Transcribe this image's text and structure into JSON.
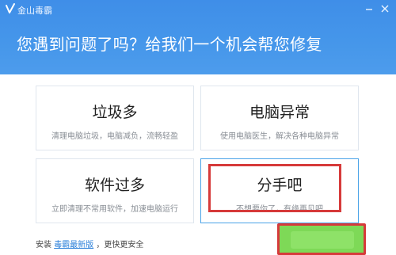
{
  "window": {
    "title": "金山毒霸"
  },
  "banner": {
    "headline": "您遇到问题了吗？给我们一个机会帮您修复"
  },
  "cards": [
    {
      "title": "垃圾多",
      "desc": "清理电脑垃圾，电脑减负，流畅轻盈"
    },
    {
      "title": "电脑异常",
      "desc": "使用电脑医生，解决各种电脑异常"
    },
    {
      "title": "软件过多",
      "desc": "立即清理不常用软件，加速电脑运行"
    },
    {
      "title": "分手吧",
      "desc": "不想要你了，有缘再见吧"
    }
  ],
  "footer": {
    "prefix": "安装",
    "link": "毒霸最新版",
    "suffix": "，更快更安全"
  },
  "colors": {
    "banner": "#4596ea",
    "highlight": "#d63a3a",
    "link": "#2a7fd9",
    "green_button": "#7ed957"
  },
  "icons": [
    "kingsoft-logo-icon",
    "minimize-icon",
    "close-icon"
  ]
}
